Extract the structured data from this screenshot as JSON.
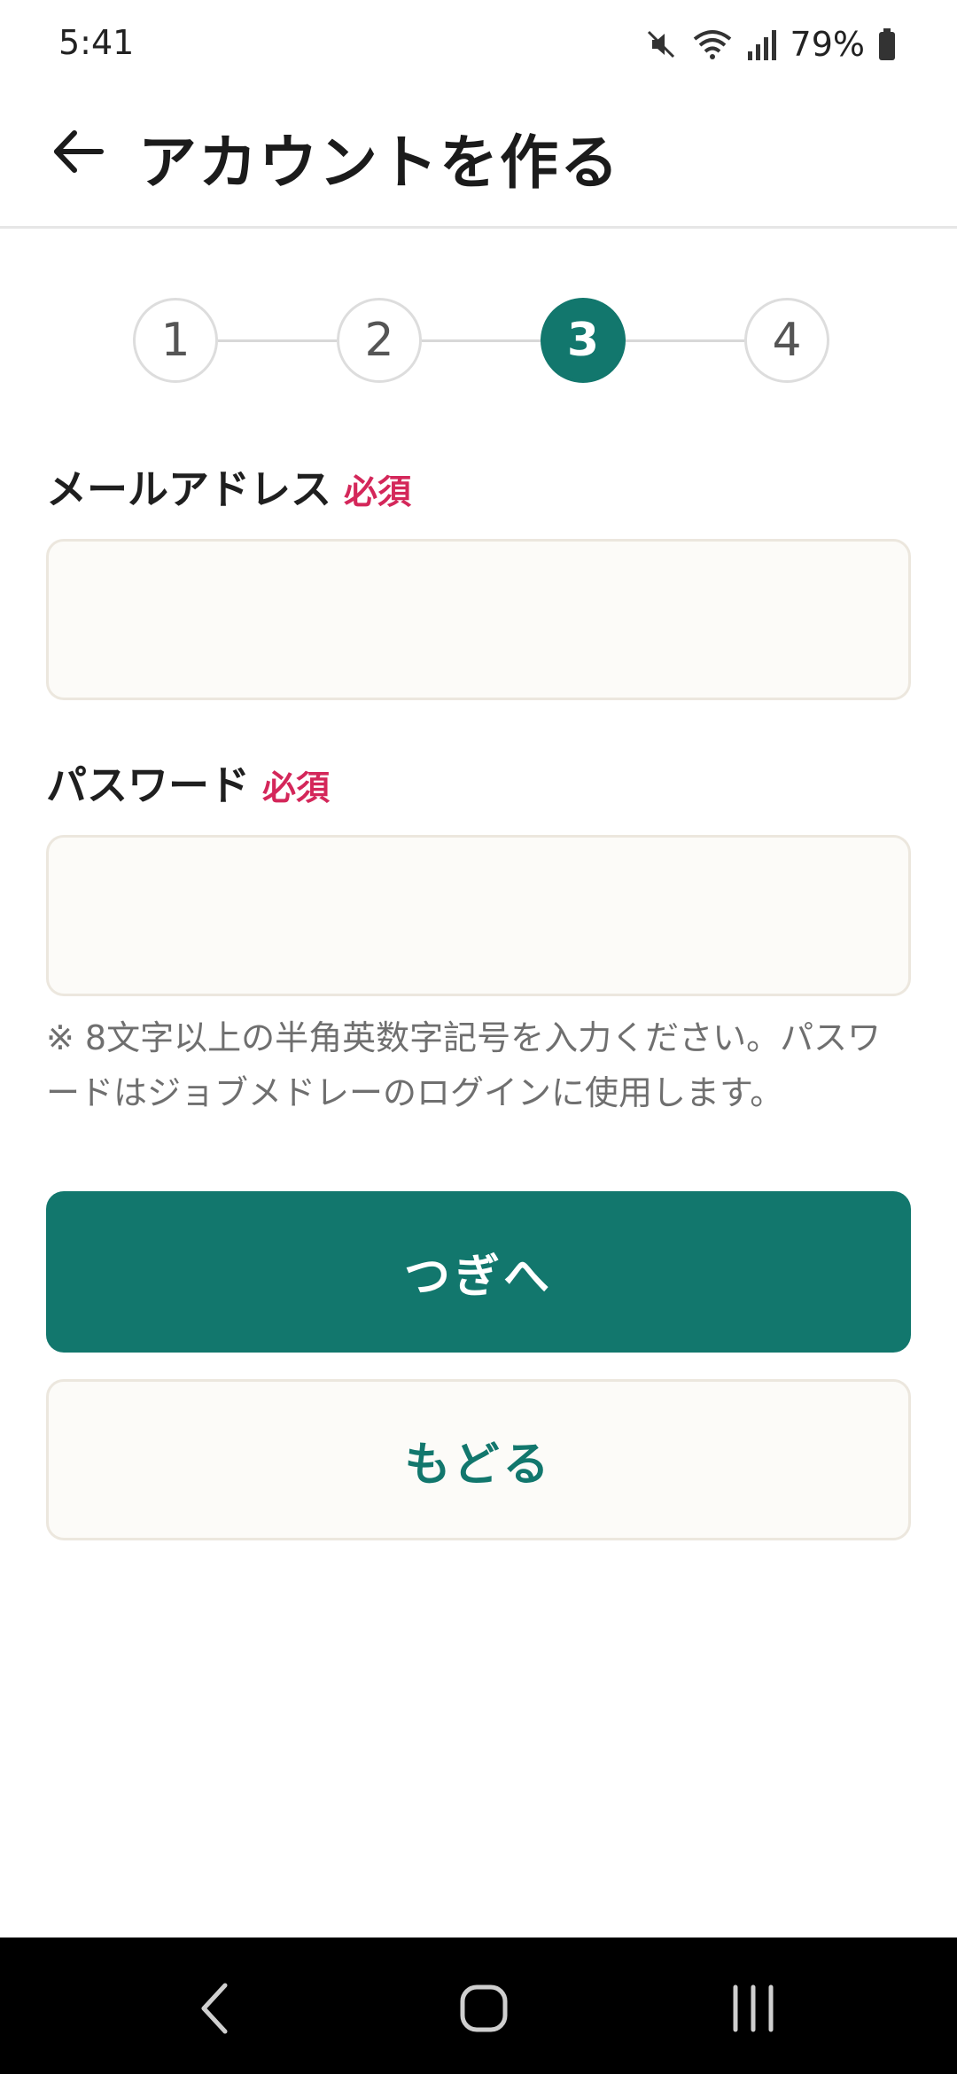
{
  "status_bar": {
    "time": "5:41",
    "battery": "79%",
    "icons": [
      "mute-icon",
      "wifi-icon",
      "signal-icon",
      "battery-icon"
    ]
  },
  "header": {
    "title": "アカウントを作る",
    "back_icon": "back-arrow-icon"
  },
  "stepper": {
    "steps": [
      "1",
      "2",
      "3",
      "4"
    ],
    "active_step": 3
  },
  "form": {
    "email": {
      "label": "メールアドレス",
      "required": "必須",
      "value": "",
      "placeholder": ""
    },
    "password": {
      "label": "パスワード",
      "required": "必須",
      "value": "",
      "placeholder": ""
    },
    "hint": "※ 8文字以上の半角英数字記号を入力ください。パスワードはジョブメドレーのログインに使用します。"
  },
  "buttons": {
    "next": "つぎへ",
    "back": "もどる"
  },
  "nav_bar": {
    "icons": [
      "nav-back-icon",
      "nav-home-icon",
      "nav-recents-icon"
    ]
  },
  "colors": {
    "accent": "#12776d",
    "required": "#d4275a",
    "input_bg": "#fcfbf8"
  }
}
